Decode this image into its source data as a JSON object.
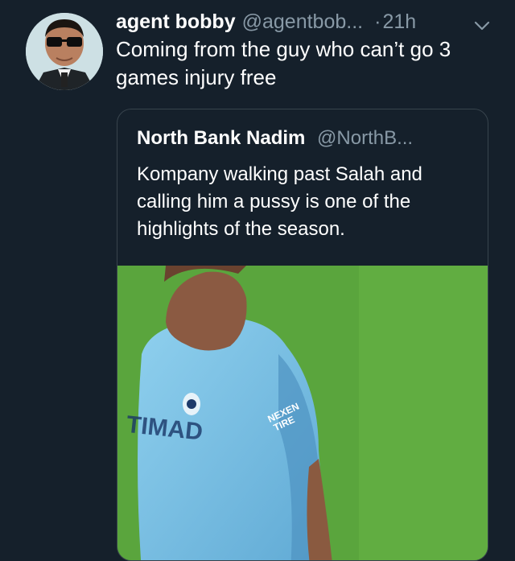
{
  "tweet": {
    "display_name": "agent bobby",
    "handle": "@agentbob...",
    "dot": "·",
    "time": "21h",
    "text": "Coming from the guy who can’t go 3 games injury free"
  },
  "quoted_tweet": {
    "display_name": "North Bank Nadim",
    "handle": "@NorthB...",
    "text": "Kompany walking past Salah and calling him a pussy is one of the highlights of the season."
  },
  "colors": {
    "background": "#15202b",
    "secondary_text": "#8899a6",
    "border": "#38444d"
  },
  "icons": {
    "menu": "chevron-down-icon"
  }
}
